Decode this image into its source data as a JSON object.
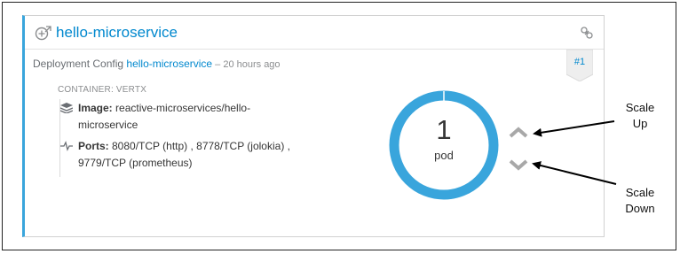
{
  "card": {
    "title": "hello-microservice",
    "subtitle_prefix": "Deployment Config ",
    "config_link": "hello-microservice",
    "subtitle_age": " – 20 hours ago",
    "revision_badge": "#1",
    "container_label": "CONTAINER: VERTX",
    "image_label": "Image:",
    "image_value_line1": " reactive-microservices/hello-",
    "image_value_line2": "microservice",
    "ports_label": "Ports:",
    "ports_value_line1": " 8080/TCP (http) , 8778/TCP (jolokia) ,",
    "ports_value_line2": "9779/TCP (prometheus)",
    "pod_count": "1",
    "pod_unit": "pod"
  },
  "annotations": {
    "scale_up_line1": "Scale",
    "scale_up_line2": "Up",
    "scale_down_line1": "Scale",
    "scale_down_line2": "Down"
  },
  "colors": {
    "accent": "#39a5dc",
    "link": "#0088ce",
    "chevron": "#a8a8a8"
  },
  "icons": [
    "deployment-icon",
    "link-icon",
    "layers-icon",
    "ports-icon",
    "chevron-up-icon",
    "chevron-down-icon"
  ]
}
